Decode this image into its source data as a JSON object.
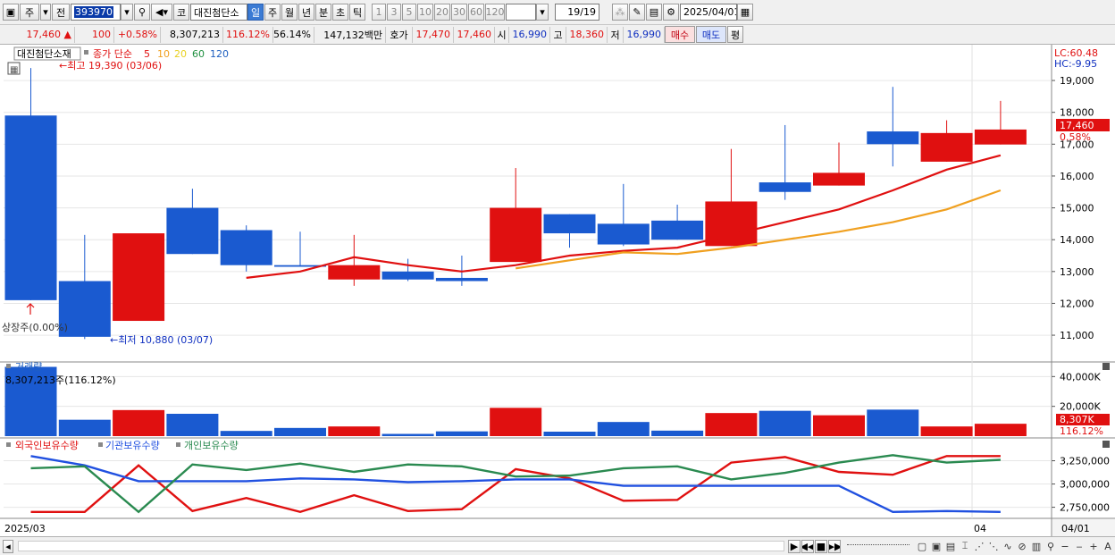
{
  "toolbar": {
    "period_type": "주",
    "prev_label": "전",
    "code": "393970",
    "market_label": "코",
    "stock_name": "대진첨단소",
    "timeframes": [
      "일",
      "주",
      "월",
      "년",
      "분",
      "초",
      "틱"
    ],
    "active_timeframe": "일",
    "intervals": [
      "1",
      "3",
      "5",
      "10",
      "20",
      "30",
      "60",
      "120"
    ],
    "count": "19/19",
    "date": "2025/04/01"
  },
  "quote": {
    "price": "17,460",
    "change_arrow": "▲",
    "change": "100",
    "change_pct": "+0.58%",
    "volume": "8,307,213",
    "volume_ratio": "116.12%",
    "turnover": "56.14%",
    "amount": "147,132백만",
    "hoga_label": "호가",
    "bid": "17,470",
    "ask": "17,460",
    "open_label": "시",
    "open": "16,990",
    "high_label": "고",
    "high": "18,360",
    "low_label": "저",
    "low": "16,990",
    "buy_label": "매수",
    "sell_label": "매도",
    "flat_label": "평"
  },
  "price_pane": {
    "stock_label": "대진첨단소재",
    "legend_title": "종가 단순",
    "ma_labels": [
      "5",
      "10",
      "20",
      "60",
      "120"
    ],
    "ma_colors": [
      "#e01010",
      "#f0a020",
      "#e8d020",
      "#209040",
      "#2060c0"
    ],
    "max_annotation": "최고 19,390 (03/06)",
    "min_annotation": "최저 10,880 (03/07)",
    "listing_annotation": "상장주(0.00%)",
    "lc_label": "LC:60.48",
    "hc_label": "HC:-9.95",
    "last_price_tag": "17,460",
    "last_pct_tag": "0.58%"
  },
  "volume_pane": {
    "title": "거래량",
    "annotation": "8,307,213주(116.12%)",
    "last_tag": "8,307K",
    "last_pct_tag": "116.12%"
  },
  "holding_pane": {
    "legend": [
      "외국인보유수량",
      "기관보유수량",
      "개인보유수량"
    ]
  },
  "xaxis": {
    "left_label": "2025/03",
    "mid_label": "04",
    "right_label": "04/01"
  },
  "chart_data": [
    {
      "type": "candlestick",
      "ylim": [
        10300,
        19900
      ],
      "yticks": [
        11000,
        12000,
        13000,
        14000,
        15000,
        16000,
        17000,
        18000,
        19000
      ],
      "ytick_labels": [
        "11,000",
        "12,000",
        "13,000",
        "14,000",
        "15,000",
        "16,000",
        "17,000",
        "18,000",
        "19,000"
      ],
      "candles": [
        {
          "o": 17900,
          "h": 19390,
          "l": 12100,
          "c": 12100
        },
        {
          "o": 12700,
          "h": 14150,
          "l": 10880,
          "c": 10950
        },
        {
          "o": 11450,
          "h": 11450,
          "l": 11450,
          "c": 14200
        },
        {
          "o": 15000,
          "h": 15600,
          "l": 13550,
          "c": 13550
        },
        {
          "o": 14300,
          "h": 14450,
          "l": 13000,
          "c": 13200
        },
        {
          "o": 13200,
          "h": 14250,
          "l": 13150,
          "c": 13150
        },
        {
          "o": 12750,
          "h": 14150,
          "l": 12550,
          "c": 13200
        },
        {
          "o": 13000,
          "h": 13400,
          "l": 12700,
          "c": 12750
        },
        {
          "o": 12800,
          "h": 13500,
          "l": 12550,
          "c": 12700
        },
        {
          "o": 13300,
          "h": 16250,
          "l": 13300,
          "c": 15000
        },
        {
          "o": 14800,
          "h": 14800,
          "l": 13750,
          "c": 14200
        },
        {
          "o": 14500,
          "h": 15750,
          "l": 13800,
          "c": 13850
        },
        {
          "o": 14600,
          "h": 15100,
          "l": 14000,
          "c": 14000
        },
        {
          "o": 13800,
          "h": 16850,
          "l": 13800,
          "c": 15200
        },
        {
          "o": 15800,
          "h": 17600,
          "l": 15250,
          "c": 15500
        },
        {
          "o": 15700,
          "h": 17050,
          "l": 15700,
          "c": 16100
        },
        {
          "o": 17400,
          "h": 18800,
          "l": 16300,
          "c": 17000
        },
        {
          "o": 16450,
          "h": 17750,
          "l": 16450,
          "c": 17350
        },
        {
          "o": 16990,
          "h": 18360,
          "l": 16990,
          "c": 17460
        }
      ],
      "ma5": [
        null,
        null,
        null,
        null,
        12800,
        13000,
        13450,
        13200,
        13000,
        13200,
        13500,
        13650,
        13750,
        14150,
        14550,
        14950,
        15550,
        16200,
        16650
      ],
      "ma10": [
        null,
        null,
        null,
        null,
        null,
        null,
        null,
        null,
        null,
        13100,
        13350,
        13600,
        13550,
        13750,
        14000,
        14250,
        14550,
        14950,
        15550
      ]
    },
    {
      "type": "bar",
      "title": "거래량",
      "ylim": [
        0,
        48000
      ],
      "yticks": [
        20000,
        40000
      ],
      "ytick_labels": [
        "20,000K",
        "40,000K"
      ],
      "values": [
        46500,
        11000,
        17500,
        15000,
        3500,
        5500,
        6500,
        1500,
        3200,
        19000,
        3000,
        9500,
        3700,
        15500,
        17000,
        14000,
        17800,
        6500,
        8307
      ],
      "up": [
        false,
        false,
        true,
        false,
        false,
        false,
        true,
        false,
        false,
        true,
        false,
        false,
        false,
        true,
        false,
        true,
        false,
        true,
        true
      ]
    },
    {
      "type": "line",
      "ylim": [
        2650000,
        3380000
      ],
      "yticks": [
        2750000,
        3000000,
        3250000
      ],
      "ytick_labels": [
        "2,750,000",
        "3,000,000",
        "3,250,000"
      ],
      "series": [
        {
          "name": "외국인보유수량",
          "color": "#e01010",
          "values": [
            2700000,
            2700000,
            3200000,
            2710000,
            2850000,
            2700000,
            2880000,
            2710000,
            2730000,
            3160000,
            3060000,
            2820000,
            2830000,
            3230000,
            3290000,
            3130000,
            3100000,
            3300000,
            3300000
          ]
        },
        {
          "name": "기관보유수량",
          "color": "#2050e0",
          "values": [
            3300000,
            3200000,
            3030000,
            3030000,
            3030000,
            3060000,
            3050000,
            3020000,
            3030000,
            3050000,
            3050000,
            2980000,
            2980000,
            2980000,
            2980000,
            2980000,
            2700000,
            2710000,
            2700000
          ]
        },
        {
          "name": "개인보유수량",
          "color": "#2a8a50",
          "values": [
            3170000,
            3190000,
            2700000,
            3210000,
            3150000,
            3220000,
            3130000,
            3210000,
            3190000,
            3080000,
            3090000,
            3170000,
            3190000,
            3050000,
            3120000,
            3230000,
            3310000,
            3230000,
            3260000
          ]
        }
      ]
    }
  ]
}
